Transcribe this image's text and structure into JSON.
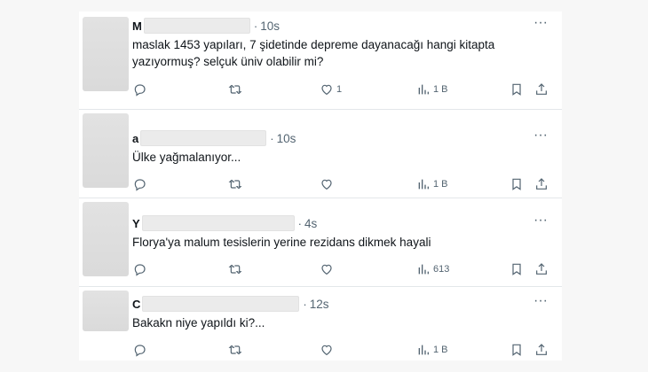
{
  "tweets": [
    {
      "initial": "M",
      "time": "10s",
      "text": "maslak 1453 yapıları, 7 şidetinde depreme dayanacağı hangi kitapta yazıyormuş? selçuk üniv olabilir mi?",
      "likes": "1",
      "views": "1 B"
    },
    {
      "initial": "a",
      "time": "10s",
      "text": "Ülke yağmalanıyor...",
      "likes": "",
      "views": "1 B"
    },
    {
      "initial": "Y",
      "time": "4s",
      "text": "Florya'ya malum tesislerin yerine rezidans dikmek hayali",
      "likes": "",
      "views": "613"
    },
    {
      "initial": "C",
      "time": "12s",
      "text": "Bakakn niye yapıldı ki?...",
      "likes": "",
      "views": "1 B"
    }
  ],
  "icons": {
    "reply": "reply-icon",
    "retweet": "retweet-icon",
    "like": "heart-icon",
    "views": "views-chart-icon",
    "bookmark": "bookmark-icon",
    "share": "share-icon",
    "more": "more-icon"
  },
  "colors": {
    "muted": "#536471",
    "text": "#0f1419",
    "divider": "#e3e7ea"
  }
}
